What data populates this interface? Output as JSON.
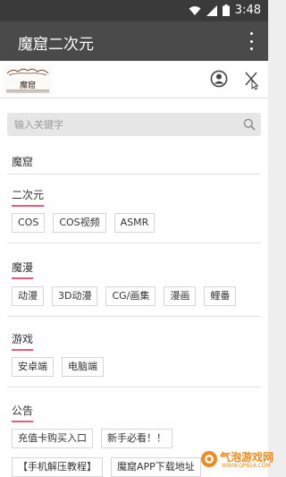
{
  "status": {
    "time": "3:48"
  },
  "app": {
    "title": "魔窟二次元"
  },
  "drawer": {
    "logo_text": "魔窟",
    "search": {
      "placeholder": "输入关键字"
    },
    "top_link": "魔窟",
    "sections": [
      {
        "title": "二次元",
        "tags": [
          "COS",
          "COS视频",
          "ASMR"
        ]
      },
      {
        "title": "魔漫",
        "tags": [
          "动漫",
          "3D动漫",
          "CG/画集",
          "漫画",
          "鲤番"
        ]
      },
      {
        "title": "游戏",
        "tags": [
          "安卓端",
          "电脑端"
        ]
      },
      {
        "title": "公告",
        "tags": [
          "充值卡购买入口",
          "新手必看！！",
          "【手机解压教程】",
          "魔窟APP下载地址"
        ]
      }
    ]
  },
  "watermark": {
    "text": "气泡游戏网",
    "sub": "WWW.QP828.COM"
  },
  "colors": {
    "accent": "#e75a7c",
    "appbar": "#4a4a4a",
    "statusbar": "#3a3a3a"
  }
}
